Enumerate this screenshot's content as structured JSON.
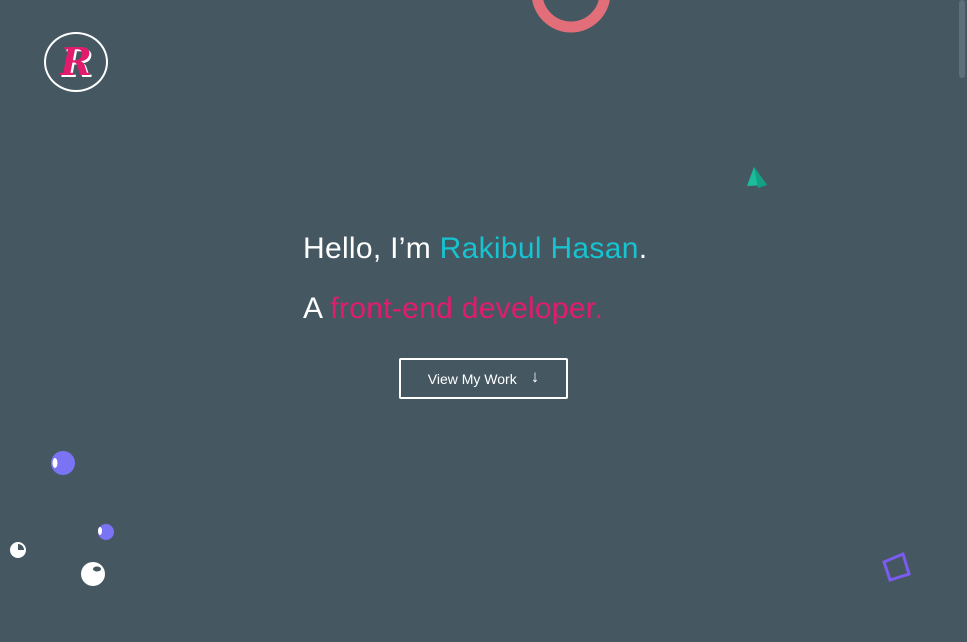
{
  "logo": {
    "letter": "R"
  },
  "hero": {
    "greeting": "Hello, I’m ",
    "name": "Rakibul Hasan",
    "name_suffix": ".",
    "prefix": "A ",
    "role": "front-end developer."
  },
  "cta": {
    "label": "View My Work",
    "icon": "arrow-down-icon",
    "arrow_glyph": "↓"
  },
  "colors": {
    "background": "#455862",
    "name_accent": "#17c3d0",
    "role_accent": "#e31b6d",
    "ring": "#e26e79",
    "triangle": "#1abc9c",
    "square": "#7b5bf0",
    "bubble": "#7a74f5"
  },
  "decorations": [
    "ring-shape",
    "triangle-shape",
    "square-shape",
    "bubble-shapes"
  ]
}
